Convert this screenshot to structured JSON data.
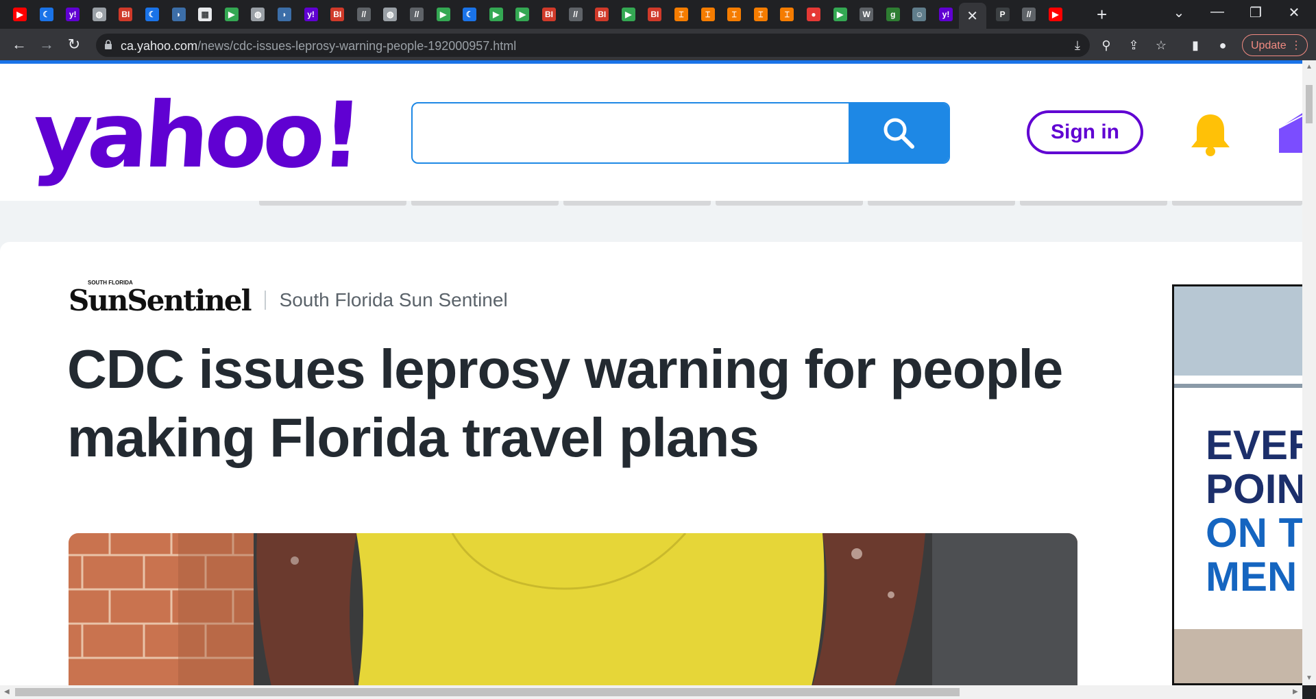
{
  "browser": {
    "tabs": [
      {
        "icon": "youtube-icon",
        "color": "#ff0000",
        "glyph": "▶"
      },
      {
        "icon": "moon-icon",
        "color": "#1a73e8",
        "glyph": "☾"
      },
      {
        "icon": "yahoo-icon",
        "color": "#6001d2",
        "glyph": "y!"
      },
      {
        "icon": "globe-icon",
        "color": "#9aa0a6",
        "glyph": "◍"
      },
      {
        "icon": "business-insider-icon",
        "color": "#d03a2a",
        "glyph": "BI"
      },
      {
        "icon": "moon-icon",
        "color": "#1a73e8",
        "glyph": "☾"
      },
      {
        "icon": "shield-icon",
        "color": "#3c6ea8",
        "glyph": "◗"
      },
      {
        "icon": "image-icon",
        "color": "#e8eaed",
        "glyph": "▦"
      },
      {
        "icon": "play-icon",
        "color": "#34a853",
        "glyph": "▶"
      },
      {
        "icon": "globe-icon",
        "color": "#9aa0a6",
        "glyph": "◍"
      },
      {
        "icon": "shield-icon",
        "color": "#3c6ea8",
        "glyph": "◗"
      },
      {
        "icon": "yahoo-icon",
        "color": "#6001d2",
        "glyph": "y!"
      },
      {
        "icon": "business-insider-icon",
        "color": "#d03a2a",
        "glyph": "BI"
      },
      {
        "icon": "slash-icon",
        "color": "#5f6368",
        "glyph": "//"
      },
      {
        "icon": "globe-icon",
        "color": "#9aa0a6",
        "glyph": "◍"
      },
      {
        "icon": "slash-icon",
        "color": "#5f6368",
        "glyph": "//"
      },
      {
        "icon": "play-icon",
        "color": "#34a853",
        "glyph": "▶"
      },
      {
        "icon": "moon-icon",
        "color": "#1a73e8",
        "glyph": "☾"
      },
      {
        "icon": "play-icon",
        "color": "#34a853",
        "glyph": "▶"
      },
      {
        "icon": "play-icon",
        "color": "#34a853",
        "glyph": "▶"
      },
      {
        "icon": "business-insider-icon",
        "color": "#d03a2a",
        "glyph": "BI"
      },
      {
        "icon": "slash-icon",
        "color": "#5f6368",
        "glyph": "//"
      },
      {
        "icon": "business-insider-icon",
        "color": "#d03a2a",
        "glyph": "BI"
      },
      {
        "icon": "play-icon",
        "color": "#34a853",
        "glyph": "▶"
      },
      {
        "icon": "business-insider-icon",
        "color": "#d03a2a",
        "glyph": "BI"
      },
      {
        "icon": "bookmark-icon",
        "color": "#f57c00",
        "glyph": "⌶"
      },
      {
        "icon": "bookmark-icon",
        "color": "#f57c00",
        "glyph": "⌶"
      },
      {
        "icon": "bookmark-icon",
        "color": "#f57c00",
        "glyph": "⌶"
      },
      {
        "icon": "bookmark-icon",
        "color": "#f57c00",
        "glyph": "⌶"
      },
      {
        "icon": "bookmark-icon",
        "color": "#f57c00",
        "glyph": "⌶"
      },
      {
        "icon": "podcast-icon",
        "color": "#e53935",
        "glyph": "●"
      },
      {
        "icon": "play-icon",
        "color": "#34a853",
        "glyph": "▶"
      },
      {
        "icon": "wp-icon",
        "color": "#5f6368",
        "glyph": "W"
      },
      {
        "icon": "g-icon",
        "color": "#2e7d32",
        "glyph": "g"
      },
      {
        "icon": "avatar-icon",
        "color": "#607d8b",
        "glyph": "☺"
      },
      {
        "icon": "yahoo-icon",
        "color": "#6001d2",
        "glyph": "y!"
      },
      {
        "icon": "active-tab-close-icon",
        "color": "#35363a",
        "glyph": "✕",
        "active": true
      },
      {
        "icon": "p-icon",
        "color": "#3c4043",
        "glyph": "P"
      },
      {
        "icon": "slash-icon",
        "color": "#5f6368",
        "glyph": "//"
      },
      {
        "icon": "youtube-icon",
        "color": "#ff0000",
        "glyph": "▶"
      }
    ],
    "address": {
      "host": "ca.yahoo.com",
      "path": "/news/cdc-issues-leprosy-warning-people-192000957.html"
    },
    "update_label": "Update"
  },
  "header": {
    "logo_text": "yahoo!",
    "search_placeholder": "",
    "signin_label": "Sign in"
  },
  "article": {
    "provider_logo": "SunSentinel",
    "provider_logo_small": "SOUTH FLORIDA",
    "provider_name": "South Florida Sun Sentinel",
    "headline": "CDC issues leprosy warning for people making Florida travel plans"
  },
  "ad": {
    "lines": [
      "EVER",
      "POIN",
      "ON T",
      "MEN"
    ]
  },
  "colors": {
    "yahoo_purple": "#6001d2",
    "search_blue": "#1e88e5",
    "headline": "#232a31",
    "bell": "#ffc107"
  }
}
